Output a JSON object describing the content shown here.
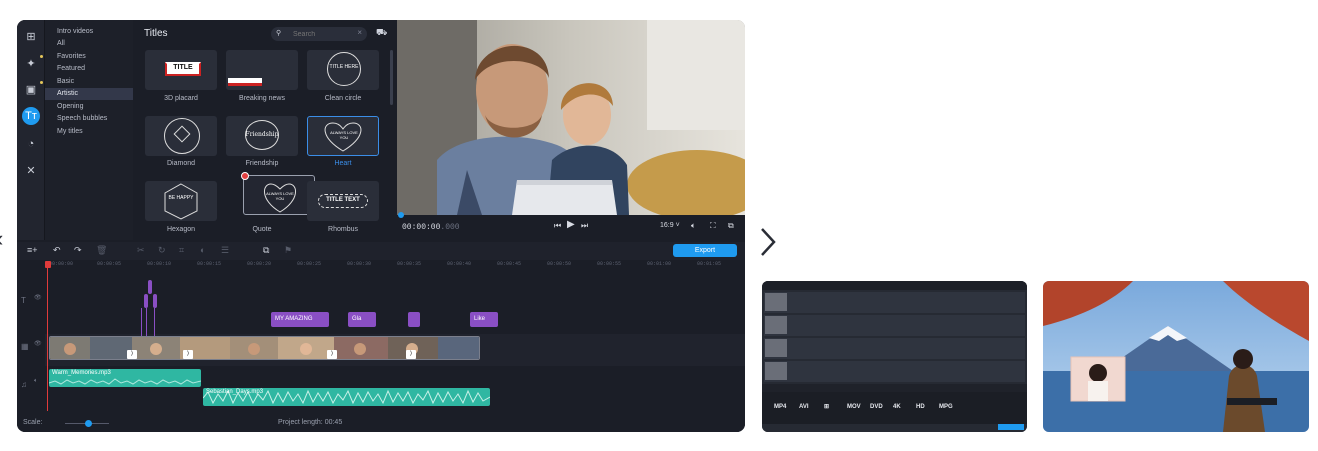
{
  "categories": [
    "Intro videos",
    "All",
    "Favorites",
    "Featured",
    "Basic",
    "Artistic",
    "Opening",
    "Speech bubbles",
    "My titles"
  ],
  "selected_category": "Artistic",
  "titles_panel": {
    "heading": "Titles",
    "search_placeholder": "Search",
    "tiles": [
      {
        "label": "3D placard",
        "text": "TITLE"
      },
      {
        "label": "Breaking news",
        "text": ""
      },
      {
        "label": "Clean circle",
        "text": "TITLE HERE"
      },
      {
        "label": "Diamond",
        "text": ""
      },
      {
        "label": "Friendship",
        "text": "Friendship"
      },
      {
        "label": "Heart",
        "text": "ALWAYS LOVE YOU"
      },
      {
        "label": "Hexagon",
        "text": "BE HAPPY"
      },
      {
        "label": "Quote",
        "text": "ALWAYS LOVE YOU"
      },
      {
        "label": "Rhombus",
        "text": "TITLE TEXT"
      }
    ],
    "selected_tile": "Heart"
  },
  "player": {
    "timecode_main": "00:00:00",
    "timecode_ms": ".000",
    "aspect_ratio": "16:9 ˅"
  },
  "toolbar": {
    "export_label": "Export"
  },
  "ruler_ticks": [
    "00:00:00",
    "00:00:05",
    "00:00:10",
    "00:00:15",
    "00:00:20",
    "00:00:25",
    "00:00:30",
    "00:00:35",
    "00:00:40",
    "00:00:45",
    "00:00:50",
    "00:00:55",
    "00:01:00",
    "00:01:05"
  ],
  "title_clips": [
    "MY AMAZING",
    "Gla",
    "",
    "Like"
  ],
  "audio_clips": [
    "Warm_Memories.mp3",
    "Sebastian_Days.mp3"
  ],
  "footer": {
    "scale_label": "Scale:",
    "project_length": "Project length:  00:45"
  },
  "colors": {
    "accent": "#1f9bf0",
    "title_clip": "#8a4fc4",
    "audio_clip": "#2fb7a2",
    "playhead": "#e03b3b"
  },
  "icons": [
    "import-icon",
    "magic-icon",
    "filter-icon",
    "titles-icon",
    "stickers-icon",
    "tools-icon",
    "undo-icon",
    "redo-icon",
    "delete-icon",
    "cut-icon",
    "rotate-icon",
    "crop-icon",
    "color-icon",
    "list-icon",
    "clip-icon",
    "flag-icon",
    "search-icon",
    "cart-icon",
    "play-icon",
    "prev-icon",
    "next-icon",
    "volume-icon",
    "fullscreen-icon",
    "detach-icon",
    "chevron-right-icon"
  ]
}
